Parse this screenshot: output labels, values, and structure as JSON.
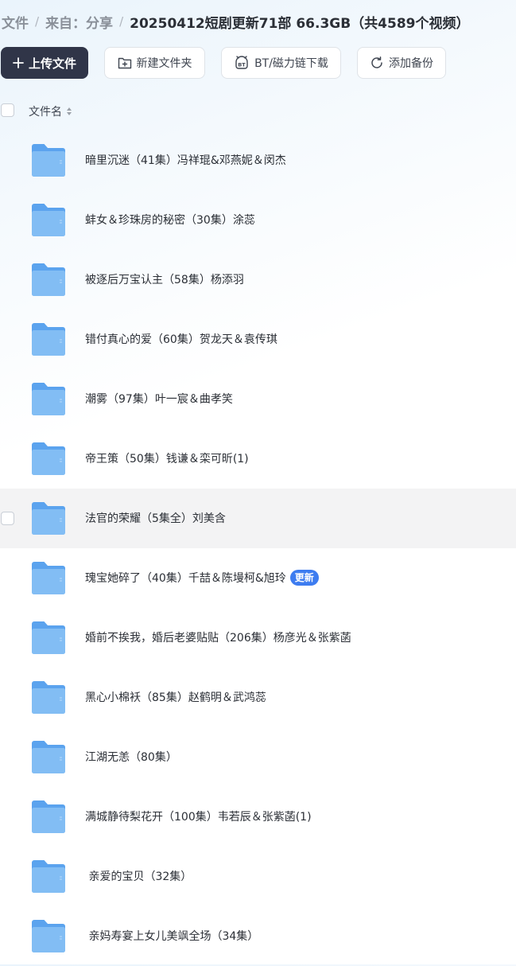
{
  "breadcrumb": {
    "items": [
      "文件",
      "来自：分享"
    ],
    "current": "20250412短剧更新71部 66.3GB（共4589个视频）"
  },
  "toolbar": {
    "upload_label": "上传文件",
    "new_folder_label": "新建文件夹",
    "bt_label": "BT/磁力链下载",
    "backup_label": "添加备份"
  },
  "list_header": {
    "name_label": "文件名"
  },
  "files": [
    {
      "name": "暗里沉迷（41集）冯祥琨&邓燕妮＆闵杰"
    },
    {
      "name": "蚌女＆珍珠房的秘密（30集）涂蕊"
    },
    {
      "name": "被逐后万宝认主（58集）杨添羽"
    },
    {
      "name": "错付真心的爱（60集）贺龙天＆袁传琪"
    },
    {
      "name": "潮雾（97集）叶一宸＆曲孝笑"
    },
    {
      "name": "帝王策（50集）钱谦＆栾可昕(1)"
    },
    {
      "name": "法官的荣耀（5集全）刘美含"
    },
    {
      "name": "瑰宝她碎了（40集）千喆＆陈墁柯&旭玲",
      "badge": "更新"
    },
    {
      "name": "婚前不挨我，婚后老婆贴贴（206集）杨彦光＆张紫菡"
    },
    {
      "name": "黑心小棉袄（85集）赵鹤明＆武鸿蕊"
    },
    {
      "name": "江湖无恙（80集）"
    },
    {
      "name": "满城静待梨花开（100集）韦若辰＆张紫菡(1)"
    },
    {
      "name": " 亲爱的宝贝（32集）"
    },
    {
      "name": " 亲妈寿宴上女儿美飒全场（34集）"
    }
  ],
  "colors": {
    "folder": "#62a8ef",
    "badge": "#3d7cf0",
    "primary_button": "#303548"
  }
}
